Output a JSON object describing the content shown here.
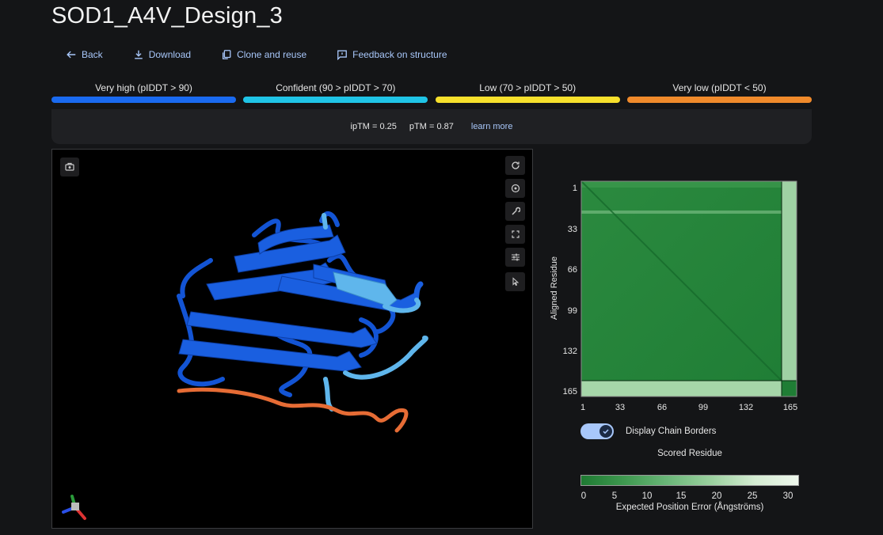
{
  "title": "SOD1_A4V_Design_3",
  "actions": {
    "back": "Back",
    "download": "Download",
    "clone": "Clone and reuse",
    "feedback": "Feedback on structure"
  },
  "legend": [
    {
      "label": "Very high (pIDDT > 90)",
      "color": "#1a6af0"
    },
    {
      "label": "Confident (90 > pIDDT > 70)",
      "color": "#1fc4e6"
    },
    {
      "label": "Low (70 > pIDDT > 50)",
      "color": "#f7e02c"
    },
    {
      "label": "Very low (pIDDT < 50)",
      "color": "#f08a2b"
    }
  ],
  "metrics": {
    "iptm": "ipTM = 0.25",
    "ptm": "pTM = 0.87",
    "learn_more": "learn more"
  },
  "viewer_tools": [
    "rotate-icon",
    "center-icon",
    "wrench-icon",
    "fullscreen-icon",
    "tune-icon",
    "pointer-icon"
  ],
  "pae": {
    "y_label": "Aligned Residue",
    "x_label": "Scored Residue",
    "ticks": [
      "1",
      "33",
      "66",
      "99",
      "132",
      "165"
    ],
    "toggle_label": "Display Chain Borders",
    "colorbar_ticks": [
      "0",
      "5",
      "10",
      "15",
      "20",
      "25",
      "30"
    ],
    "colorbar_label": "Expected Position Error (Ångströms)"
  },
  "colors": {
    "accent": "#a8c7fa",
    "background": "#141517",
    "pae_low": "#1e7a32",
    "pae_high": "#eef7ec"
  }
}
